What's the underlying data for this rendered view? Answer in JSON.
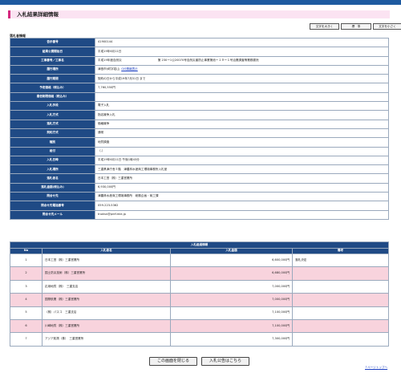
{
  "page": {
    "title": "入札結果詳細情報",
    "section_label": "落札者情報",
    "text_size_buttons": [
      "文字を大きく",
      "標　準",
      "文字を小さく"
    ],
    "page_top_link": "↑ページトップへ"
  },
  "info_rows": [
    {
      "label": "告示番号",
      "value": "41900144"
    },
    {
      "label": "結果公開開始日",
      "value": "平成19年6月11日"
    },
    {
      "label": "工事番号／工事名",
      "value": "平成19年度自然災",
      "value2": "第 230ー1公20070号自然災害防止事業第池ー１９ー１号治業調査等業務委託"
    },
    {
      "label": "履行場所",
      "value": "津島市ｶ町字若山",
      "link": "GIS情報表示"
    },
    {
      "label": "履行期間",
      "value": "契約の日から平成19年7月31日 まで"
    },
    {
      "label": "予定価格（税込み）",
      "value": "7,760,550円"
    },
    {
      "label": "最低制限価格（税込み）",
      "value": ""
    },
    {
      "label": "入札手段",
      "value": "電子入札"
    },
    {
      "label": "入札方式",
      "value": "指名競争入札"
    },
    {
      "label": "落札方式",
      "value": "価格競争"
    },
    {
      "label": "契約方式",
      "value": "通常"
    },
    {
      "label": "種別",
      "value": "地質調査"
    },
    {
      "label": "格付",
      "value": "（-）"
    },
    {
      "label": "入札日時",
      "value": "平成19年6月11日 午後1時43分"
    },
    {
      "label": "入札場所",
      "value": "三重県津庁舎３階　津農林水産商工環境事務所入札室"
    },
    {
      "label": "落札者名",
      "value": "日本工営（株）三重営業所"
    },
    {
      "label": "落札金額(税込み)",
      "value": "6,930,000円"
    },
    {
      "label": "問合せ先",
      "value": "津農林水産商工環境事務所　総務企画・商工課"
    },
    {
      "label": "問合せ先電話番号",
      "value": "059-223-5362"
    },
    {
      "label": "問合せ先メール",
      "value": "tnoksn@pref.mie.jp"
    }
  ],
  "results": {
    "caption": "入札経過情報",
    "headers": {
      "no": "No",
      "name": "入札者名",
      "amount": "入札金額",
      "note": "備考"
    },
    "rows": [
      {
        "no": "1",
        "name": "日本工営（株）三重営業所",
        "amount": "6,600,000円",
        "note": "落札決定"
      },
      {
        "no": "2",
        "name": "国土防災技術（株）三重営業所",
        "amount": "6,680,000円",
        "note": ""
      },
      {
        "no": "3",
        "name": "応用地質（株）　三重支店",
        "amount": "7,000,000円",
        "note": ""
      },
      {
        "no": "4",
        "name": "国際航業（株）三重営業所",
        "amount": "7,000,000円",
        "note": ""
      },
      {
        "no": "5",
        "name": "（株）パスコ　三重支店",
        "amount": "7,100,000円",
        "note": ""
      },
      {
        "no": "6",
        "name": "川崎地質（株）三重営業所",
        "amount": "7,100,000円",
        "note": ""
      },
      {
        "no": "7",
        "name": "アジア航測（株）　三重営業所",
        "amount": "7,300,000円",
        "note": ""
      }
    ]
  },
  "buttons": {
    "close": "この画面を閉じる",
    "notice": "入札公告はこちら"
  }
}
